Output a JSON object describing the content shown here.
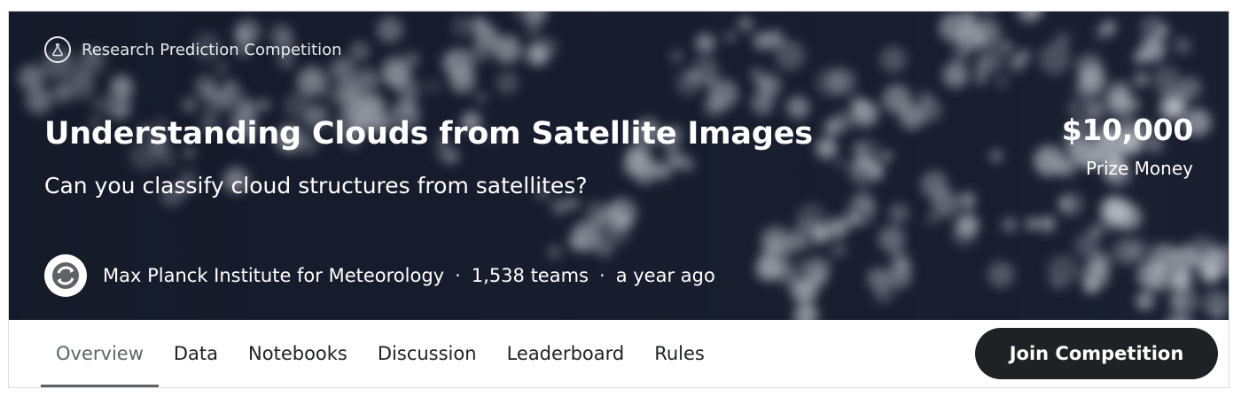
{
  "competition": {
    "type_label": "Research Prediction Competition",
    "title": "Understanding Clouds from Satellite Images",
    "subtitle": "Can you classify cloud structures from satellites?",
    "prize": {
      "amount": "$10,000",
      "label": "Prize Money"
    },
    "host": {
      "name": "Max Planck Institute for Meteorology",
      "teams": "1,538 teams",
      "time": "a year ago",
      "separator": "·"
    }
  },
  "tabs": [
    {
      "label": "Overview",
      "active": true
    },
    {
      "label": "Data"
    },
    {
      "label": "Notebooks"
    },
    {
      "label": "Discussion"
    },
    {
      "label": "Leaderboard"
    },
    {
      "label": "Rules"
    }
  ],
  "actions": {
    "join_label": "Join Competition"
  },
  "icons": {
    "competition_type": "flask-icon",
    "host_logo": "host-logo-icon"
  },
  "colors": {
    "hero_bg": "#1b2133",
    "button_bg": "#202124",
    "active_tab": "#5f6368"
  }
}
